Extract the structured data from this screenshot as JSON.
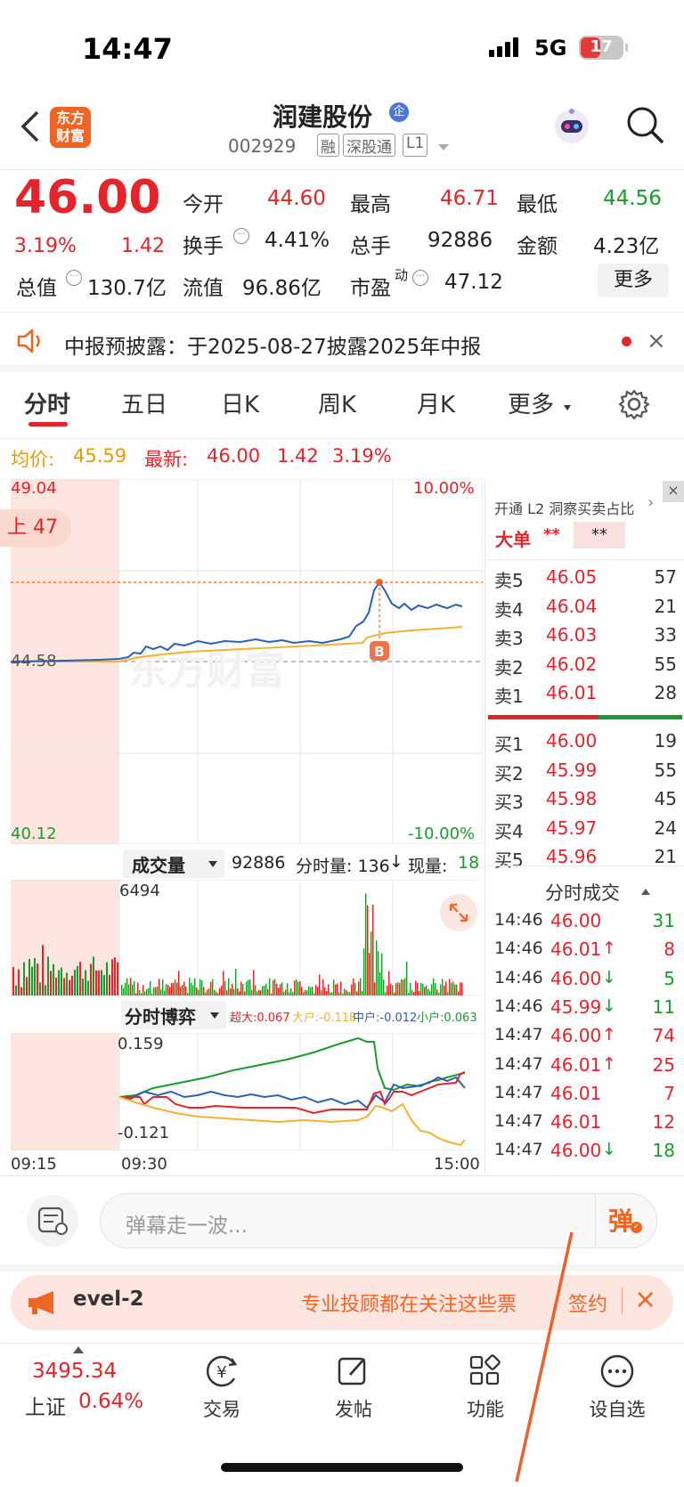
{
  "status": {
    "time": "14:47",
    "network": "5G",
    "battery": "17"
  },
  "header": {
    "logo_text_1": "东方",
    "logo_text_2": "财富",
    "title": "润建股份",
    "title_badge": "企",
    "code": "002929",
    "tags": [
      "融",
      "深股通",
      "L1"
    ]
  },
  "quote": {
    "price": "46.00",
    "change_pct": "3.19%",
    "change": "1.42",
    "open_label": "今开",
    "open": "44.60",
    "high_label": "最高",
    "high": "46.71",
    "low_label": "最低",
    "low": "44.56",
    "turnover_label": "换手",
    "turnover": "4.41%",
    "volume_label": "总手",
    "volume": "92886",
    "amount_label": "金额",
    "amount": "4.23亿",
    "mktcap_label": "总值",
    "mktcap": "130.7亿",
    "float_label": "流值",
    "float_cap": "96.86亿",
    "pe_label": "市盈",
    "pe_sup": "动",
    "pe": "47.12",
    "more_label": "更多"
  },
  "notice": {
    "text": "中报预披露：于2025-08-27披露2025年中报"
  },
  "tabs": [
    "分时",
    "五日",
    "日K",
    "周K",
    "月K",
    "更多"
  ],
  "active_tab": "分时",
  "price_info": {
    "avg_label": "均价:",
    "avg": "45.59",
    "latest_label": "最新:",
    "latest": "46.00",
    "change": "1.42",
    "pct": "3.19%"
  },
  "chart": {
    "y_max": "49.04",
    "y_min": "40.12",
    "pct_max": "10.00%",
    "pct_min": "-10.00%",
    "prev_close": "44.58",
    "pre_badge": "上 47",
    "watermark": "东方财富",
    "b_marker": "B",
    "vol_selector": "成交量",
    "vol_total": "92886",
    "vol_bar_label": "分时量: 136",
    "vol_now_label": "现量:",
    "vol_now": "18",
    "vol_max": "6494",
    "game_selector": "分时博弈",
    "game_legend": [
      {
        "label": "超大:0.067",
        "color": "#e6232b"
      },
      {
        "label": "大户:-0.118",
        "color": "#f3b230"
      },
      {
        "label": "中户:-0.012",
        "color": "#2c5fb5"
      },
      {
        "label": "小户:0.063",
        "color": "#1a9b2e"
      }
    ],
    "game_max": "0.159",
    "game_min": "-0.121",
    "x_labels": [
      "09:15",
      "09:30",
      "15:00"
    ]
  },
  "chart_data": {
    "type": "line",
    "x_range": [
      "09:15",
      "15:00"
    ],
    "ylim": [
      40.12,
      49.04
    ],
    "prev_close": 44.58,
    "series": [
      {
        "name": "最新",
        "color": "#2c5fb5"
      },
      {
        "name": "均价",
        "color": "#f3b230"
      }
    ]
  },
  "l2": {
    "title": "开通 L2 洞察买卖占比",
    "big_label": "大单",
    "big_val1": "**",
    "big_val2": "**"
  },
  "orderbook": {
    "asks": [
      {
        "label": "卖5",
        "price": "46.05",
        "vol": "57"
      },
      {
        "label": "卖4",
        "price": "46.04",
        "vol": "21"
      },
      {
        "label": "卖3",
        "price": "46.03",
        "vol": "33"
      },
      {
        "label": "卖2",
        "price": "46.02",
        "vol": "55"
      },
      {
        "label": "卖1",
        "price": "46.01",
        "vol": "28"
      }
    ],
    "bids": [
      {
        "label": "买1",
        "price": "46.00",
        "vol": "19"
      },
      {
        "label": "买2",
        "price": "45.99",
        "vol": "55"
      },
      {
        "label": "买3",
        "price": "45.98",
        "vol": "45"
      },
      {
        "label": "买4",
        "price": "45.97",
        "vol": "24"
      },
      {
        "label": "买5",
        "price": "45.96",
        "vol": "21"
      }
    ]
  },
  "ticks": {
    "title": "分时成交",
    "rows": [
      {
        "time": "14:46",
        "price": "46.00",
        "arrow": "",
        "vol": "31",
        "vol_color": "green"
      },
      {
        "time": "14:46",
        "price": "46.01",
        "arrow": "↑",
        "vol": "8",
        "vol_color": "red"
      },
      {
        "time": "14:46",
        "price": "46.00",
        "arrow": "↓",
        "vol": "5",
        "vol_color": "green"
      },
      {
        "time": "14:46",
        "price": "45.99",
        "arrow": "↓",
        "vol": "11",
        "vol_color": "green"
      },
      {
        "time": "14:47",
        "price": "46.00",
        "arrow": "↑",
        "vol": "74",
        "vol_color": "red"
      },
      {
        "time": "14:47",
        "price": "46.01",
        "arrow": "↑",
        "vol": "25",
        "vol_color": "red"
      },
      {
        "time": "14:47",
        "price": "46.01",
        "arrow": "",
        "vol": "7",
        "vol_color": "red"
      },
      {
        "time": "14:47",
        "price": "46.01",
        "arrow": "",
        "vol": "12",
        "vol_color": "red"
      },
      {
        "time": "14:47",
        "price": "46.00",
        "arrow": "↓",
        "vol": "18",
        "vol_color": "green"
      }
    ]
  },
  "danmu": {
    "placeholder": "弹幕走一波...",
    "button": "弹"
  },
  "banner": {
    "left": "evel-2",
    "text": "专业投顾都在关注这些票",
    "sign": "签约"
  },
  "bottom_nav": {
    "index_value": "3495.34",
    "index_name": "上证",
    "index_pct": "0.64%",
    "items": [
      "交易",
      "发帖",
      "功能",
      "设自选"
    ]
  }
}
